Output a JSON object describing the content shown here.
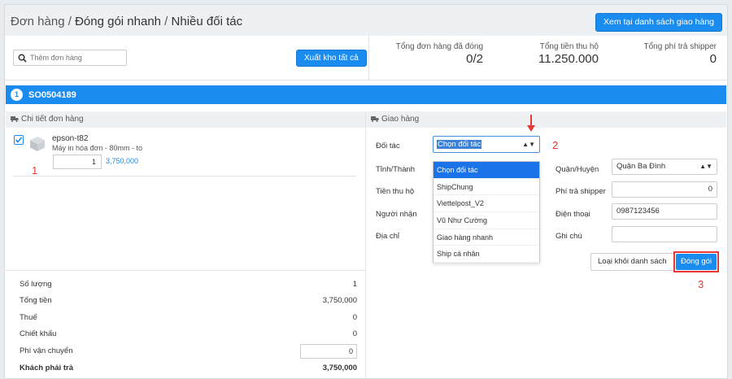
{
  "breadcrumb": {
    "part1": "Đơn hàng",
    "sep1": " / ",
    "part2": "Đóng gói nhanh",
    "sep2": " / ",
    "part3": "Nhiều đối tác"
  },
  "header": {
    "view_list_button": "Xem tại danh sách giao hàng"
  },
  "toolbar": {
    "search_placeholder": "Thêm đơn hàng",
    "export_button": "Xuất kho tất cả",
    "stats": [
      {
        "label": "Tổng đơn hàng đã đóng",
        "value": "0/2"
      },
      {
        "label": "Tổng tiền thu hộ",
        "value": "11.250.000"
      },
      {
        "label": "Tổng phí trả shipper",
        "value": "0"
      }
    ]
  },
  "order": {
    "index": "1",
    "code": "SO0504189"
  },
  "order_detail": {
    "title": "Chi tiết đơn hàng",
    "product": {
      "name": "epson-t82",
      "description": "Máy in hóa đơn - 80mm - to",
      "quantity": "1",
      "price": "3,750,000",
      "checked": true
    },
    "marker_1": "1"
  },
  "summary": [
    {
      "label": "Số lượng",
      "value": "1"
    },
    {
      "label": "Tổng tiền",
      "value": "3,750,000"
    },
    {
      "label": "Thuế",
      "value": "0"
    },
    {
      "label": "Chiết khấu",
      "value": "0"
    },
    {
      "label": "Phí vận chuyển",
      "value": "0"
    },
    {
      "label": "Khách phải trả",
      "value": "3,750,000"
    }
  ],
  "delivery": {
    "title": "Giao hàng",
    "labels": {
      "partner": "Đối tác",
      "province": "Tỉnh/Thành",
      "cod": "Tiền thu hộ",
      "receiver": "Người nhận",
      "address": "Địa chỉ",
      "district": "Quận/Huyện",
      "shipper_fee": "Phí trả shipper",
      "phone": "Điện thoại",
      "note": "Ghi chú"
    },
    "partner_selected": "Chọn đối tác",
    "partner_options": [
      "Chọn đối tác",
      "ShipChung",
      "Viettelpost_V2",
      "Vũ Như Cường",
      "Giao hàng nhanh",
      "Ship cá nhân"
    ],
    "district_value": "Quận Ba Đình",
    "shipper_fee_value": "0",
    "phone_value": "0987123456",
    "note_value": "",
    "remove_button": "Loại khỏi danh sách",
    "pack_button": "Đóng gói",
    "marker_2": "2",
    "marker_3": "3"
  },
  "colors": {
    "primary": "#1a8bef",
    "annotation": "#e53935",
    "header_bg": "#eef1f4"
  }
}
